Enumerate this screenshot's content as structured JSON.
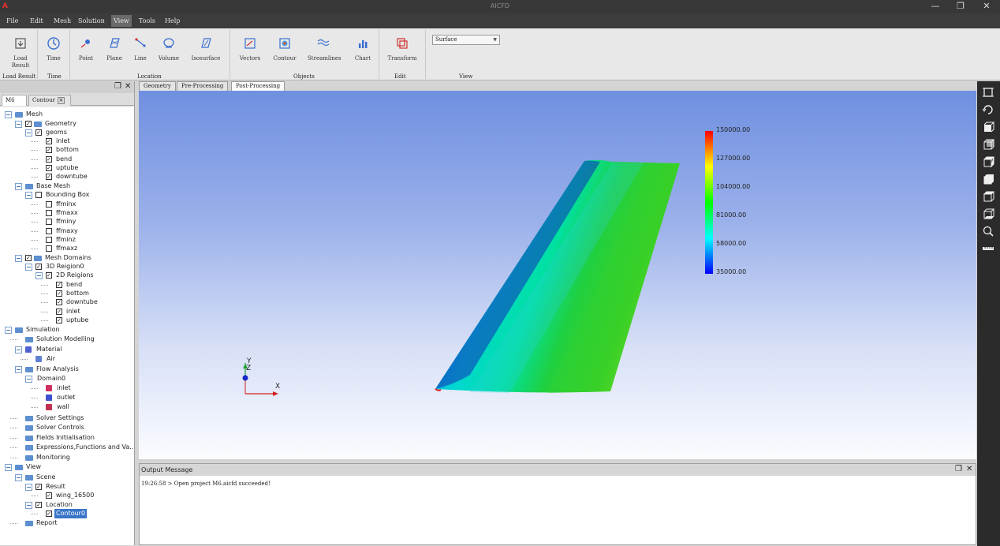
{
  "window": {
    "title": "AICFD",
    "minimize": "—",
    "maximize": "❐",
    "close": "✕"
  },
  "menu": [
    "File",
    "Edit",
    "Mesh",
    "Solution",
    "View",
    "Tools",
    "Help"
  ],
  "menu_active": "View",
  "ribbon": {
    "load_result": "Load\nResult",
    "time": "Time",
    "point": "Point",
    "plane": "Plane",
    "line": "Line",
    "volume": "Volume",
    "isosurface": "Isosurface",
    "vectors": "Vectors",
    "contour": "Contour",
    "streamlines": "Streamlines",
    "chart": "Chart",
    "transform": "Transform",
    "surface_select": "Surface",
    "groups": {
      "load_result": "Load Result",
      "time": "Time",
      "location": "Location",
      "objects": "Objects",
      "edit": "Edit",
      "view": "View"
    }
  },
  "left_panel": {
    "tabs": [
      "M6",
      "Contour"
    ],
    "tree": [
      "Mesh",
      "Geometry",
      "geoms",
      "inlet",
      "bottom",
      "bend",
      "uptube",
      "downtube",
      "Base Mesh",
      "Bounding Box",
      "ffminx",
      "ffmaxx",
      "ffminy",
      "ffmaxy",
      "ffminz",
      "ffmaxz",
      "Mesh Domains",
      "3D Reigion0",
      "2D Reigions",
      "bend",
      "bottom",
      "downtube",
      "inlet",
      "uptube",
      "Simulation",
      "Solution Modelling",
      "Material",
      "Air",
      "Flow Analysis",
      "Domain0",
      "inlet",
      "outlet",
      "wall",
      "Solver Settings",
      "Solver Controls",
      "Fields Initialisation",
      "Expressions,Functions and Va...",
      "Monitoring",
      "View",
      "Scene",
      "Result",
      "wing_16500",
      "Location",
      "Contour0",
      "Report"
    ]
  },
  "doc_tabs": [
    "Geometry",
    "Pre-Processing",
    "Post-Processing"
  ],
  "doc_tab_active": "Post-Processing",
  "legend": {
    "values": [
      "150000.00",
      "127000.00",
      "104000.00",
      "81000.00",
      "58000.00",
      "35000.00"
    ],
    "colors": [
      "#ff0000",
      "#ffff00",
      "#00ff00",
      "#00ffff",
      "#0000ff"
    ]
  },
  "axes": {
    "x": "X",
    "y": "Y",
    "z": "Z"
  },
  "output": {
    "title": "Output Message",
    "log": "19:26:58 > Open project M6.aicfd succeeded!"
  },
  "right_tools": [
    "fit-view-icon",
    "rotate-icon",
    "view-front-icon",
    "view-back-icon",
    "view-left-icon",
    "view-right-icon",
    "view-top-icon",
    "view-bottom-icon",
    "zoom-icon",
    "ruler-icon"
  ]
}
